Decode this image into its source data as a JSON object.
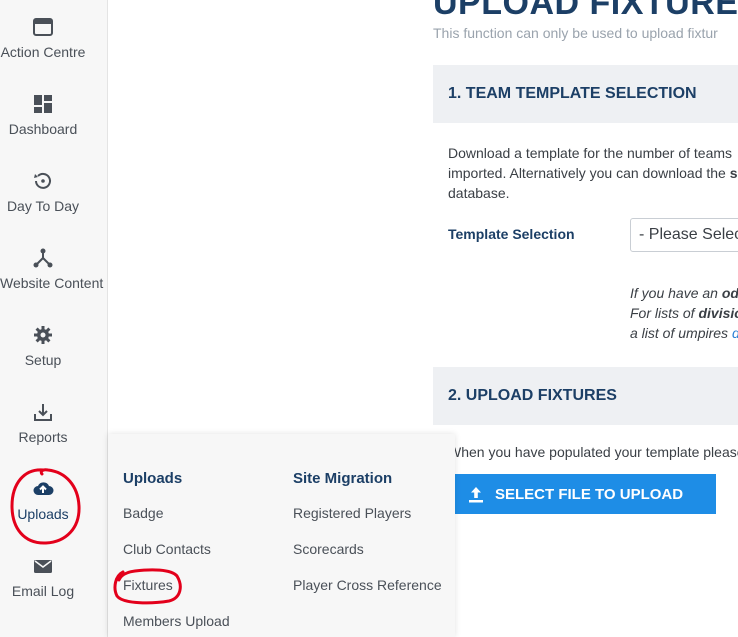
{
  "sidebar": {
    "items": [
      {
        "label": "Action Centre",
        "icon": "window-icon"
      },
      {
        "label": "Dashboard",
        "icon": "dashboard-icon"
      },
      {
        "label": "Day To Day",
        "icon": "history-icon"
      },
      {
        "label": "Website Content",
        "icon": "share-nodes-icon"
      },
      {
        "label": "Setup",
        "icon": "gear-icon"
      },
      {
        "label": "Reports",
        "icon": "download-tray-icon"
      },
      {
        "label": "Uploads",
        "icon": "cloud-upload-icon"
      },
      {
        "label": "Email Log",
        "icon": "envelope-icon"
      }
    ]
  },
  "main": {
    "title": "UPLOAD FIXTURES",
    "subtitle": "This function can only be used to upload fixtur",
    "section1": {
      "title": "1. TEAM TEMPLATE SELECTION",
      "desc_line1": "Download a template for the number of teams",
      "desc_line2_a": "imported. Alternatively you can download the ",
      "desc_line2_b": "s",
      "desc_line3": "database.",
      "template_label": "Template Selection",
      "template_select_value": "- Please Selec",
      "note1_a": "If you have an ",
      "note1_b": "odd",
      "note2_a": "For lists of ",
      "note2_b": "divisio",
      "note3_a": "a list of umpires ",
      "note3_b": "d"
    },
    "section2": {
      "title": "2. UPLOAD FIXTURES",
      "desc": "When you have populated your template please",
      "button_label": "SELECT FILE TO UPLOAD"
    }
  },
  "dropdown": {
    "uploads_heading": "Uploads",
    "uploads_items": [
      "Badge",
      "Club Contacts",
      "Fixtures",
      "Members Upload"
    ],
    "migration_heading": "Site Migration",
    "migration_items": [
      "Registered Players",
      "Scorecards",
      "Player Cross Reference"
    ]
  },
  "colors": {
    "brand": "#1c3f66",
    "button": "#1e8de6",
    "annotation": "#e3001b"
  }
}
